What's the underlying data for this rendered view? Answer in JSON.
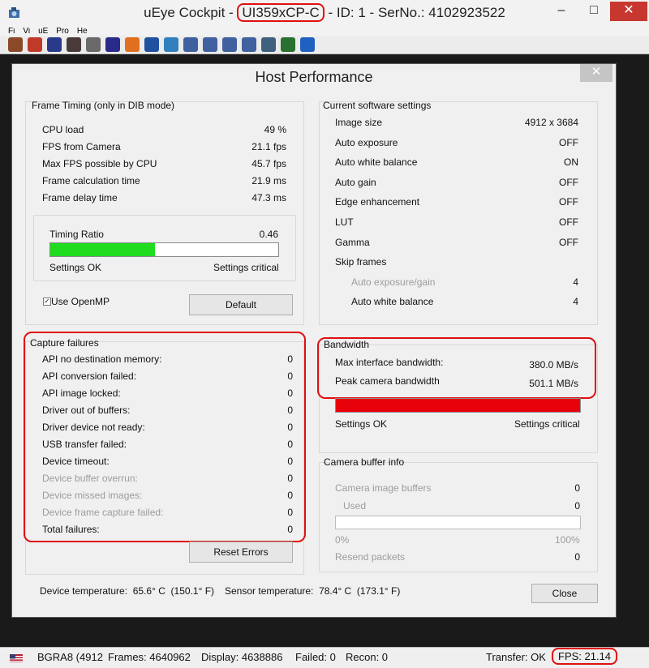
{
  "app": {
    "title_prefix": "uEye Cockpit - ",
    "title_model": "UI359xCP-C",
    "title_suffix": " - ID: 1 - SerNo.: 4102923522",
    "minimize": "–",
    "maximize": "□",
    "close": "✕"
  },
  "menu": [
    "Fi",
    "Vi",
    "uE",
    "Pro",
    "He"
  ],
  "toolbar": {
    "icons": [
      "probe-icon",
      "camera-icon",
      "diamond-icon",
      "diamond-dark-icon",
      "wrench-icon",
      "eye-icon",
      "color-icon",
      "save-icon",
      "fit-icon",
      "zoom-icon",
      "zoom-in-icon",
      "zoom-out-icon",
      "zoom-reset-icon",
      "histogram-icon",
      "magnify-icon",
      "help-icon"
    ],
    "colors": [
      "#8a4a2a",
      "#c03a2a",
      "#2a3a8a",
      "#4a3a3a",
      "#6a6a6a",
      "#2a2a8a",
      "#e07020",
      "#2050a0",
      "#3080c0",
      "#4060a0",
      "#4060a0",
      "#4060a0",
      "#4060a0",
      "#406080",
      "#2a7030",
      "#2060c0"
    ]
  },
  "dialog": {
    "title": "Host Performance",
    "close": "✕"
  },
  "frame_timing": {
    "title": "Frame Timing (only in DIB mode)",
    "rows": [
      {
        "label": "CPU load",
        "value": "49 %"
      },
      {
        "label": "FPS from Camera",
        "value": "21.1 fps"
      },
      {
        "label": "Max FPS possible by CPU",
        "value": "45.7 fps"
      },
      {
        "label": "Frame calculation time",
        "value": "21.9 ms"
      },
      {
        "label": "Frame delay time",
        "value": "47.3 ms"
      }
    ],
    "timing_ratio_label": "Timing Ratio",
    "timing_ratio_value": "0.46",
    "timing_ratio_fraction": 0.46,
    "ok_label": "Settings OK",
    "critical_label": "Settings critical",
    "openmp_label": "Use OpenMP",
    "openmp_checked": true,
    "default_button": "Default"
  },
  "capture_failures": {
    "title": "Capture failures",
    "rows": [
      {
        "label": "API no destination memory:",
        "value": "0",
        "dim": false
      },
      {
        "label": "API conversion failed:",
        "value": "0",
        "dim": false
      },
      {
        "label": "API image locked:",
        "value": "0",
        "dim": false
      },
      {
        "label": "Driver out of buffers:",
        "value": "0",
        "dim": false
      },
      {
        "label": "Driver device not ready:",
        "value": "0",
        "dim": false
      },
      {
        "label": "USB transfer failed:",
        "value": "0",
        "dim": false
      },
      {
        "label": "Device timeout:",
        "value": "0",
        "dim": false
      },
      {
        "label": "Device buffer overrun:",
        "value": "0",
        "dim": true
      },
      {
        "label": "Device missed images:",
        "value": "0",
        "dim": true
      },
      {
        "label": "Device frame capture failed:",
        "value": "0",
        "dim": true
      },
      {
        "label": "Total failures:",
        "value": "0",
        "dim": false
      }
    ],
    "reset_button": "Reset Errors"
  },
  "software_settings": {
    "title": "Current software settings",
    "rows": [
      {
        "label": "Image size",
        "value": "4912 x 3684",
        "dim": false,
        "indent": false
      },
      {
        "label": "Auto exposure",
        "value": "OFF",
        "dim": false,
        "indent": false
      },
      {
        "label": "Auto white balance",
        "value": "ON",
        "dim": false,
        "indent": false
      },
      {
        "label": "Auto gain",
        "value": "OFF",
        "dim": false,
        "indent": false
      },
      {
        "label": "Edge enhancement",
        "value": "OFF",
        "dim": false,
        "indent": false
      },
      {
        "label": "LUT",
        "value": "OFF",
        "dim": false,
        "indent": false
      },
      {
        "label": "Gamma",
        "value": "OFF",
        "dim": false,
        "indent": false
      },
      {
        "label": "Skip frames",
        "value": "",
        "dim": false,
        "indent": false
      },
      {
        "label": "Auto exposure/gain",
        "value": "4",
        "dim": true,
        "indent": true
      },
      {
        "label": "Auto white balance",
        "value": "4",
        "dim": false,
        "indent": true
      }
    ]
  },
  "bandwidth": {
    "title": "Bandwidth",
    "rows": [
      {
        "label": "Max interface bandwidth:",
        "value": "380.0 MB/s"
      },
      {
        "label": "Peak camera bandwidth",
        "value": "501.1 MB/s"
      }
    ],
    "bar_fraction": 1.0,
    "bar_color": "#e8000b",
    "ok_label": "Settings OK",
    "critical_label": "Settings critical"
  },
  "camera_buffer": {
    "title": "Camera buffer info",
    "images_label": "Camera image buffers",
    "images_value": "0",
    "used_label": "Used",
    "used_value": "0",
    "used_fraction": 0.0,
    "min_label": "0%",
    "max_label": "100%",
    "resend_label": "Resend packets",
    "resend_value": "0"
  },
  "temperatures": {
    "device_label": "Device temperature:",
    "device_value": "65.6° C  (150.1° F)",
    "sensor_label": "Sensor temperature:",
    "sensor_value": "78.4° C  (173.1° F)"
  },
  "close_button": "Close",
  "status": {
    "format": "BGRA8 (4912",
    "frames": "Frames: 4640962",
    "display": "Display: 4638886",
    "failed": "Failed: 0",
    "recon": "Recon: 0",
    "transfer": "Transfer: OK",
    "fps": "FPS: 21.14"
  },
  "colors": {
    "ok_green": "#1fdc1f",
    "critical_red": "#e8000b",
    "highlight": "#e01010"
  }
}
